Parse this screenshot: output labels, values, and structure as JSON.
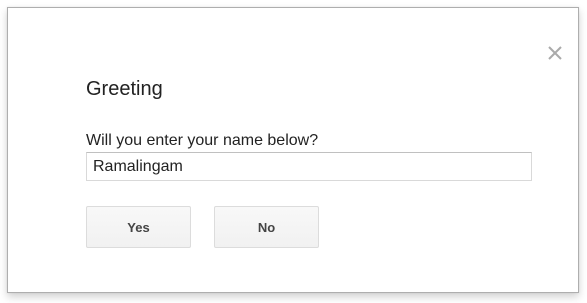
{
  "dialog": {
    "title": "Greeting",
    "prompt": "Will you enter your name below?",
    "input_value": "Ramalingam",
    "close_icon": "close-icon",
    "buttons": {
      "yes_label": "Yes",
      "no_label": "No"
    }
  },
  "colors": {
    "text": "#222222",
    "button_text": "#444444",
    "border": "#aeaeae",
    "close_icon": "#aaaaaa"
  }
}
